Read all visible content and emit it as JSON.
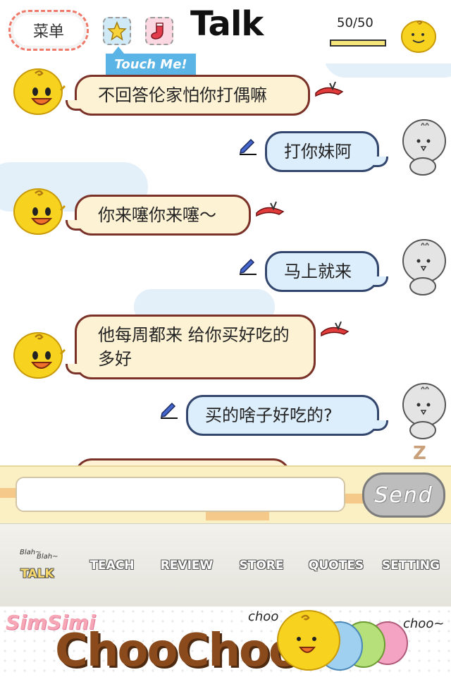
{
  "header": {
    "menu_label": "菜单",
    "title": "Talk",
    "counter_text": "50/50",
    "counter_fraction": 1.0,
    "tooltip": "Touch Me!",
    "icons": [
      "star-icon",
      "sock-icon"
    ]
  },
  "chat": {
    "messages": [
      {
        "side": "left",
        "text": "不回答伦家怕你打偶嘛"
      },
      {
        "side": "right",
        "text": "打你妹阿"
      },
      {
        "side": "left",
        "text": "你来噻你来噻～"
      },
      {
        "side": "right",
        "text": "马上就来"
      },
      {
        "side": "left",
        "text": "他每周都来 给你买好吃的 多好"
      },
      {
        "side": "right",
        "text": "买的啥子好吃的?"
      }
    ]
  },
  "input": {
    "value": "",
    "placeholder": "",
    "send_label": "Send",
    "z_mark": "Z"
  },
  "tabs": {
    "blah1": "Blah~",
    "blah2": "Blah~",
    "items": [
      {
        "label": "TALK",
        "active": true
      },
      {
        "label": "TEACH",
        "active": false
      },
      {
        "label": "REVIEW",
        "active": false
      },
      {
        "label": "STORE",
        "active": false
      },
      {
        "label": "QUOTES",
        "active": false
      },
      {
        "label": "SETTING",
        "active": false
      }
    ]
  },
  "banner": {
    "brand_small": "SimSimi",
    "brand_big": "ChooChoo",
    "choo_left": "choo",
    "choo_right": "choo~"
  },
  "colors": {
    "accent_blue": "#5ab4e6",
    "chick_yellow": "#f7d320",
    "left_bubble": "#fdf2d4",
    "right_bubble": "#dcedfb"
  }
}
